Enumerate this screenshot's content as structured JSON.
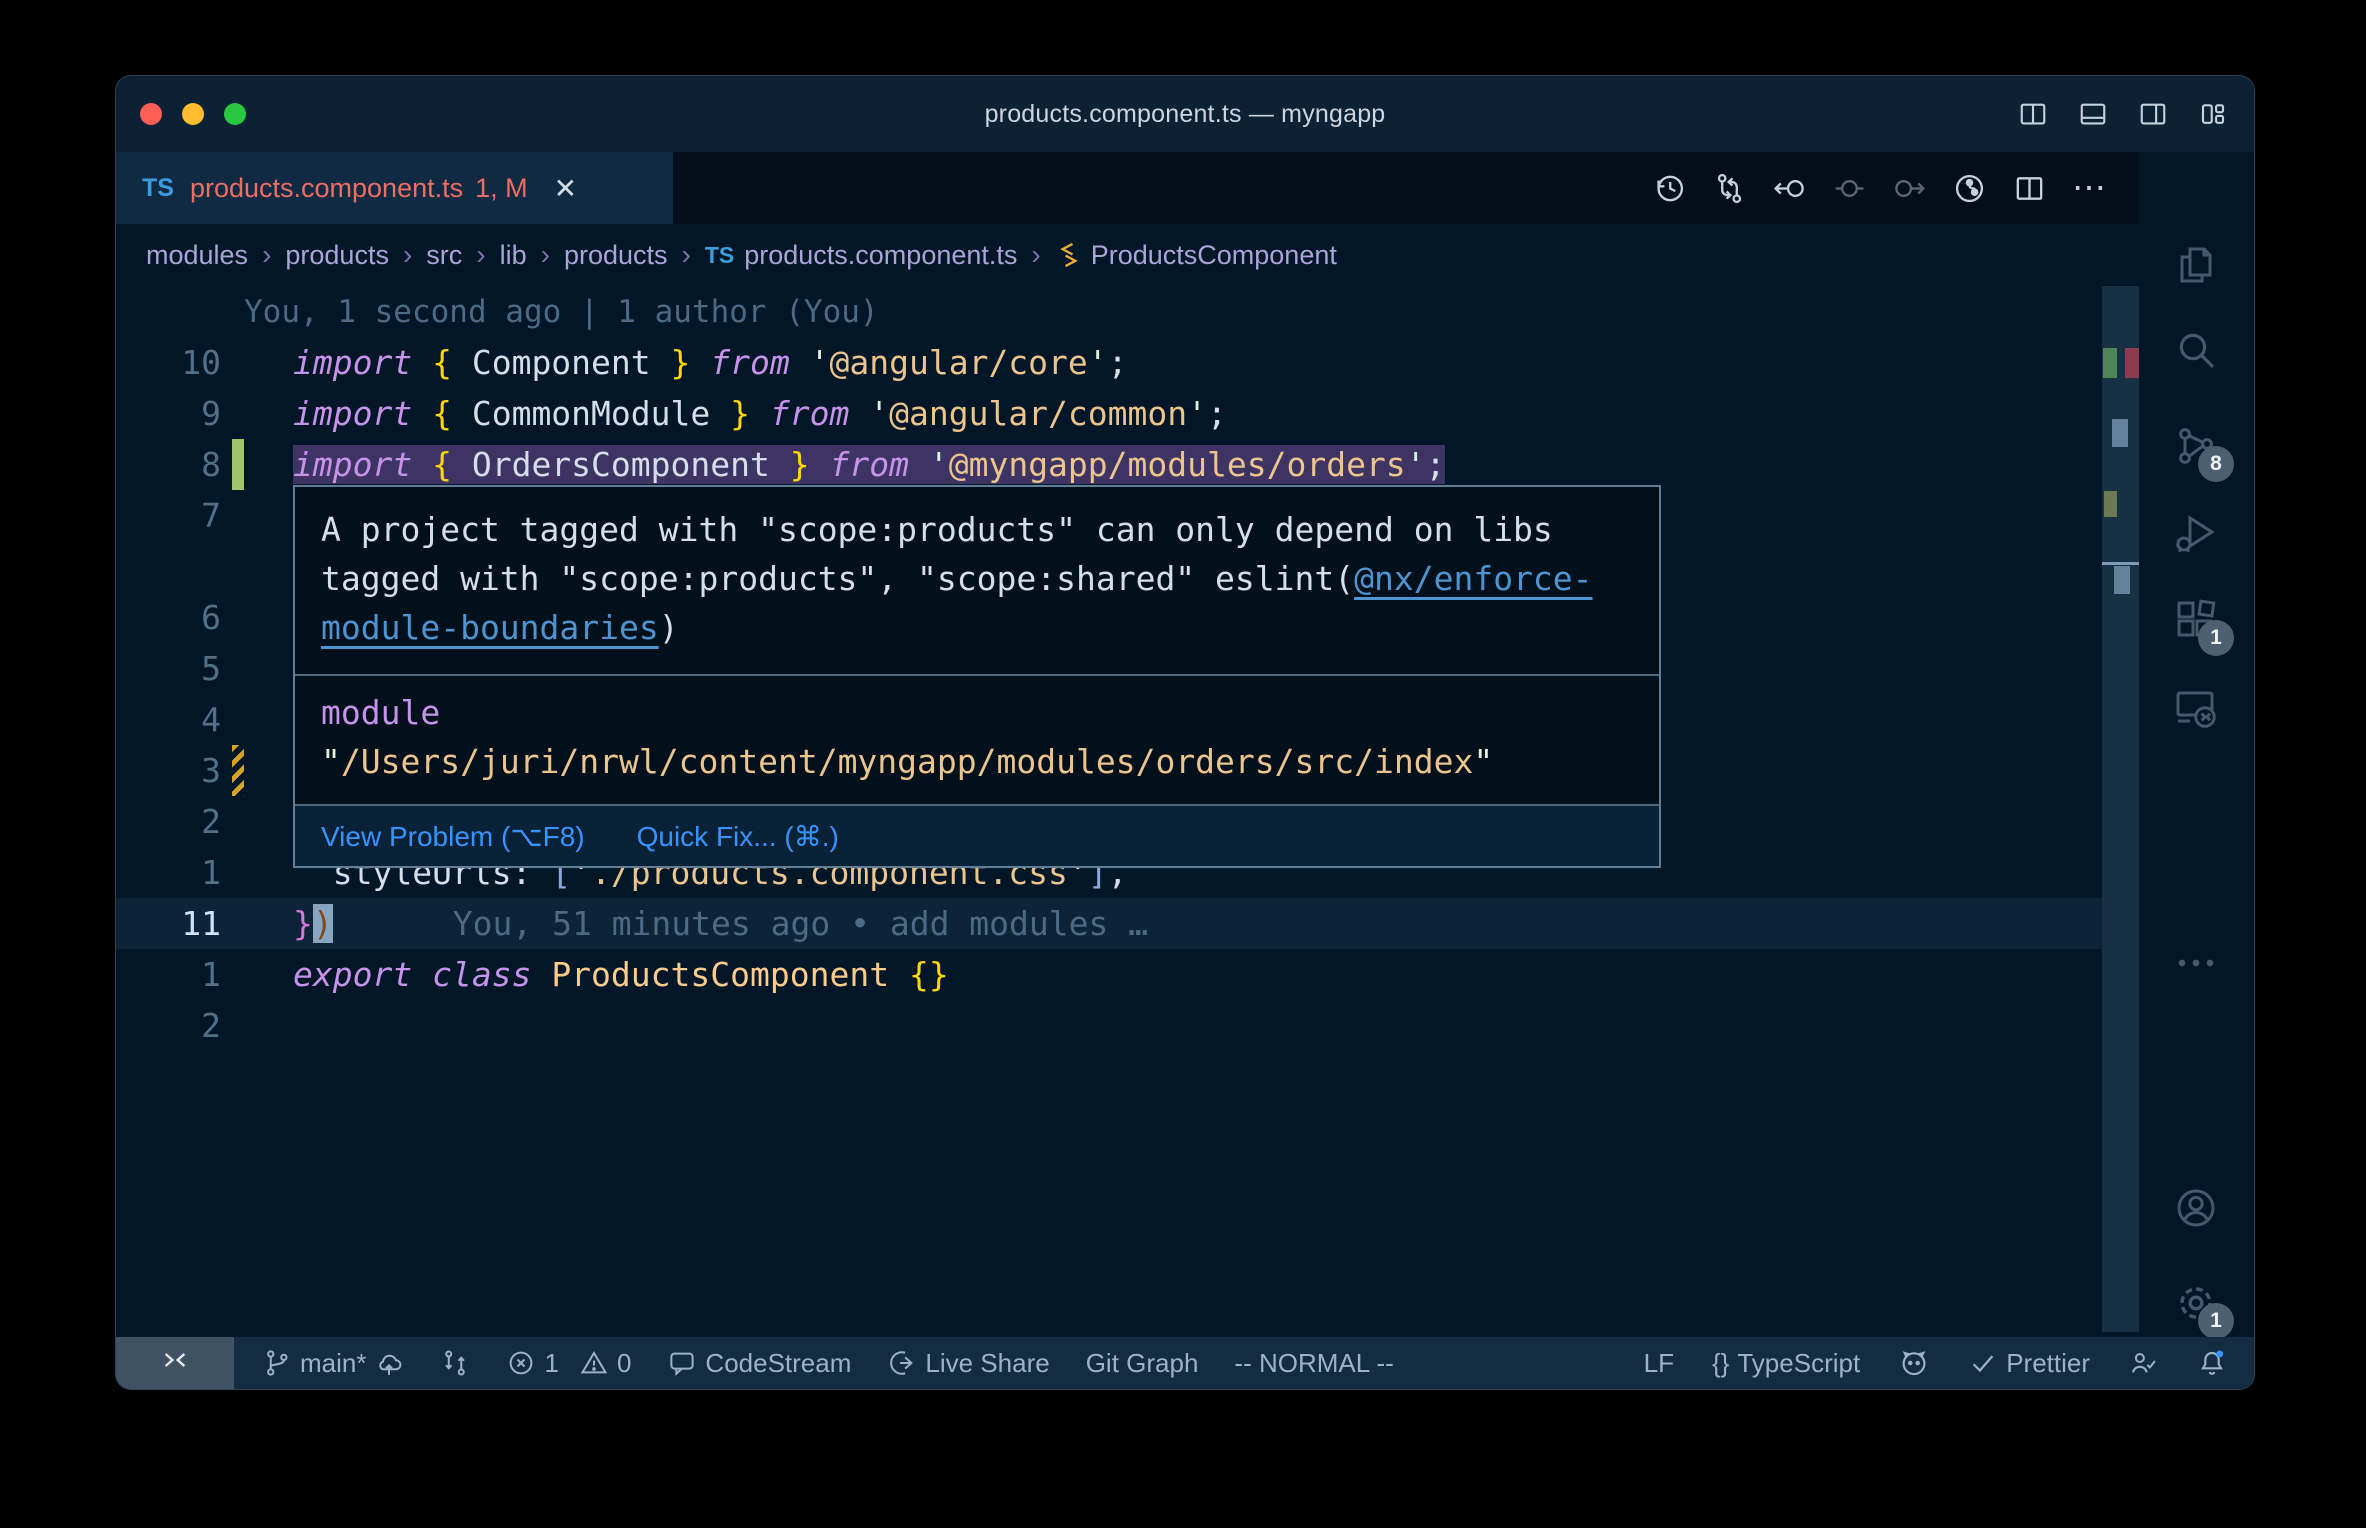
{
  "window": {
    "title": "products.component.ts — myngapp"
  },
  "tab": {
    "file_type": "TS",
    "label": "products.component.ts",
    "badge": "1, M",
    "close_glyph": "✕"
  },
  "toolbar": {
    "more_glyph": "⋯"
  },
  "breadcrumb": {
    "sep": "›",
    "items": [
      "modules",
      "products",
      "src",
      "lib",
      "products"
    ],
    "file_type": "TS",
    "file": "products.component.ts",
    "symbol": "ProductsComponent"
  },
  "editor": {
    "rows": [
      {
        "num": "",
        "blame": "You, 1 second ago | 1 author (You)"
      },
      {
        "num": "10",
        "tokens": [
          {
            "t": "import",
            "c": "kw"
          },
          {
            "t": " ",
            "c": "fg"
          },
          {
            "t": "{",
            "c": "gold"
          },
          {
            "t": " Component ",
            "c": "fg"
          },
          {
            "t": "}",
            "c": "gold"
          },
          {
            "t": " ",
            "c": "fg"
          },
          {
            "t": "from",
            "c": "kw"
          },
          {
            "t": " ",
            "c": "fg"
          },
          {
            "t": "'",
            "c": "strq"
          },
          {
            "t": "@angular/core",
            "c": "str"
          },
          {
            "t": "'",
            "c": "strq"
          },
          {
            "t": ";",
            "c": "fg"
          }
        ]
      },
      {
        "num": "9",
        "tokens": [
          {
            "t": "import",
            "c": "kw"
          },
          {
            "t": " ",
            "c": "fg"
          },
          {
            "t": "{",
            "c": "gold"
          },
          {
            "t": " CommonModule ",
            "c": "fg"
          },
          {
            "t": "}",
            "c": "gold"
          },
          {
            "t": " ",
            "c": "fg"
          },
          {
            "t": "from",
            "c": "kw"
          },
          {
            "t": " ",
            "c": "fg"
          },
          {
            "t": "'",
            "c": "strq"
          },
          {
            "t": "@angular/common",
            "c": "str"
          },
          {
            "t": "'",
            "c": "strq"
          },
          {
            "t": ";",
            "c": "fg"
          }
        ]
      },
      {
        "num": "8",
        "tokens": [
          {
            "t": "import",
            "c": "kw"
          },
          {
            "t": " ",
            "c": "fg"
          },
          {
            "t": "{",
            "c": "gold"
          },
          {
            "t": " OrdersComponent ",
            "c": "fg"
          },
          {
            "t": "}",
            "c": "gold"
          },
          {
            "t": " ",
            "c": "fg"
          },
          {
            "t": "from",
            "c": "kw"
          },
          {
            "t": " ",
            "c": "fg"
          },
          {
            "t": "'",
            "c": "strq"
          },
          {
            "t": "@myngapp/modules/orders",
            "c": "str"
          },
          {
            "t": "'",
            "c": "strq"
          },
          {
            "t": ";",
            "c": "fg"
          }
        ]
      },
      {
        "num": "7"
      },
      {
        "num": ""
      },
      {
        "num": "6"
      },
      {
        "num": "5"
      },
      {
        "num": "4"
      },
      {
        "num": "3"
      },
      {
        "num": "2"
      },
      {
        "num": "1",
        "tokens": [
          {
            "t": "  ",
            "c": "fg"
          },
          {
            "t": "styleUrls",
            "c": "fg"
          },
          {
            "t": ": ",
            "c": "fg"
          },
          {
            "t": "[",
            "c": "brkt"
          },
          {
            "t": "'",
            "c": "strq"
          },
          {
            "t": "./products.component.css",
            "c": "str"
          },
          {
            "t": "'",
            "c": "strq"
          },
          {
            "t": "]",
            "c": "brkt"
          },
          {
            "t": ",",
            "c": "fg"
          }
        ]
      },
      {
        "num": "11",
        "tokens": [
          {
            "t": "}",
            "c": "pink"
          },
          {
            "t": ")",
            "c": "cparen"
          }
        ],
        "blame": "You, 51 minutes ago • add modules …"
      },
      {
        "num": "1",
        "tokens": [
          {
            "t": "export",
            "c": "kw"
          },
          {
            "t": " ",
            "c": "fg"
          },
          {
            "t": "class",
            "c": "kw"
          },
          {
            "t": " ",
            "c": "fg"
          },
          {
            "t": "ProductsComponent",
            "c": "cls"
          },
          {
            "t": " ",
            "c": "fg"
          },
          {
            "t": "{}",
            "c": "gold"
          }
        ]
      },
      {
        "num": "2"
      }
    ]
  },
  "popup": {
    "message_parts": [
      {
        "t": "A project tagged with \"scope:products\" can only depend on libs tagged with \"scope:products\", \"scope:shared\" eslint(",
        "c": "pfg"
      },
      {
        "t": "@nx/enforce-module-boundaries",
        "c": "plink"
      },
      {
        "t": ")",
        "c": "pfg"
      }
    ],
    "module_label": "module",
    "module_parts": [
      {
        "t": "\"",
        "c": "pq"
      },
      {
        "t": "/Users/juri/nrwl/content/myngapp/modules/orders/src/index",
        "c": "pstr"
      },
      {
        "t": "\"",
        "c": "pq"
      }
    ],
    "actions": [
      "View Problem (⌥F8)",
      "Quick Fix... (⌘.)"
    ]
  },
  "status_bar": {
    "branch": "main*",
    "errors": "1",
    "warnings": "0",
    "codestream": "CodeStream",
    "live_share": "Live Share",
    "git_graph": "Git Graph",
    "mode": "-- NORMAL --",
    "eol": "LF",
    "lang_prefix": "{}",
    "language": "TypeScript",
    "prettier": "Prettier"
  },
  "activity_bar": {
    "items": [
      {
        "name": "explorer"
      },
      {
        "name": "search"
      },
      {
        "name": "source-control",
        "badge": "8"
      },
      {
        "name": "run-and-debug"
      },
      {
        "name": "extensions",
        "badge": "1"
      },
      {
        "name": "remote-explorer"
      },
      {
        "name": "more"
      },
      {
        "name": "accounts"
      },
      {
        "name": "settings",
        "badge": "1"
      }
    ]
  },
  "colors": {
    "editor_background": "#011627",
    "active_tab_background": "#0f2a42",
    "tab_error_text": "#ed6e62",
    "keyword_purple": "#c792ea",
    "string_tan": "#ecc48d",
    "brace_gold": "#ffd700",
    "class_orange": "#ffcb8b",
    "link_blue": "#4e94d0",
    "action_blue": "#3794ff",
    "squiggle_green": "#2fd34c",
    "gutter_added_green": "#9fc56f",
    "gutter_modified_gold": "#d7a324",
    "line_highlight_purple": "#3d3464",
    "traffic_red": "#ff5f57",
    "traffic_yellow": "#febc2e",
    "traffic_green": "#28c840"
  }
}
